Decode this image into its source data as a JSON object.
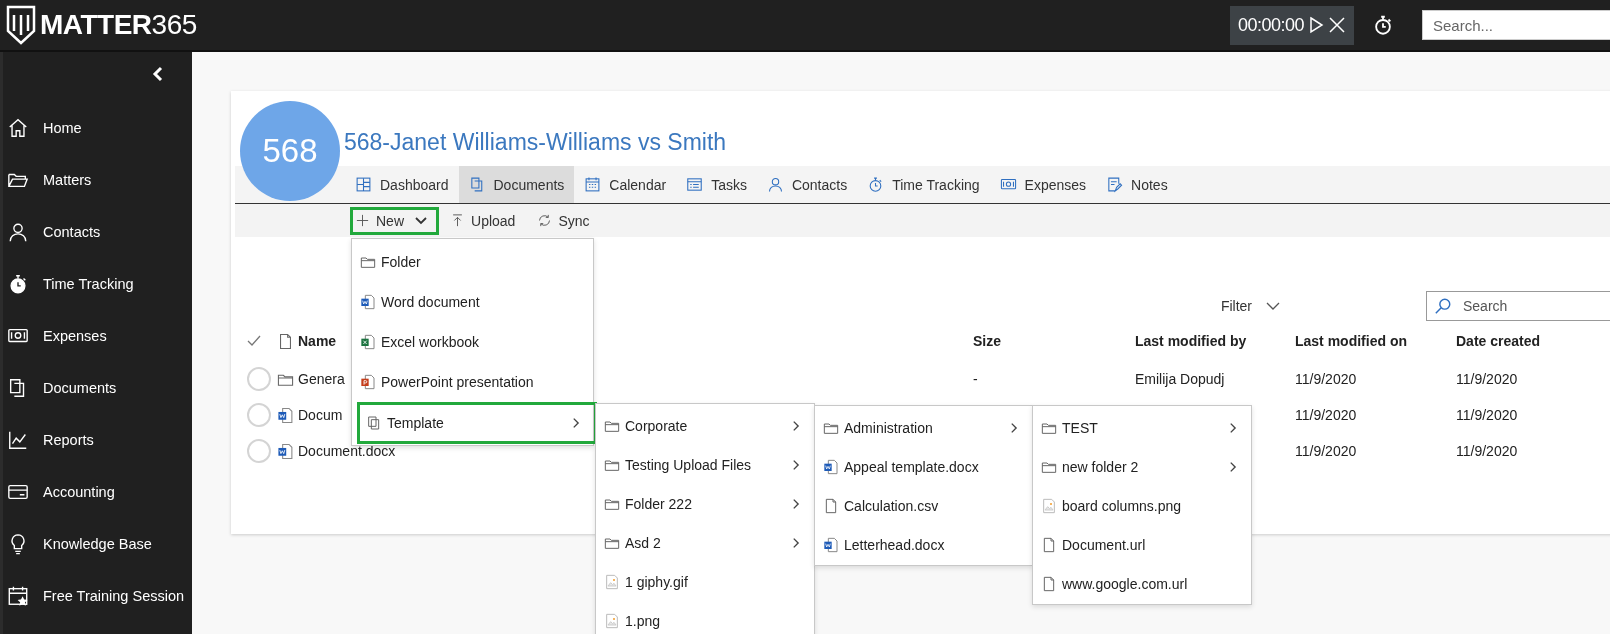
{
  "topbar": {
    "logo": {
      "name": "MATTER",
      "suffix": "365"
    },
    "timer": {
      "time": "00:00:00"
    },
    "search": {
      "placeholder": "Search..."
    }
  },
  "sidebar": {
    "items": [
      {
        "kind": "home",
        "label": "Home"
      },
      {
        "kind": "folder-open",
        "label": "Matters"
      },
      {
        "kind": "person",
        "label": "Contacts"
      },
      {
        "kind": "stopwatch-filled",
        "label": "Time Tracking"
      },
      {
        "kind": "money",
        "label": "Expenses"
      },
      {
        "kind": "documents",
        "label": "Documents"
      },
      {
        "kind": "chart",
        "label": "Reports"
      },
      {
        "kind": "card",
        "label": "Accounting"
      },
      {
        "kind": "bulb",
        "label": "Knowledge Base"
      },
      {
        "kind": "calendar-star",
        "label": "Free Training Session"
      }
    ]
  },
  "matter": {
    "number": "568",
    "title": "568-Janet Williams-Williams vs Smith"
  },
  "tabs": [
    {
      "kind": "dashboard",
      "label": "Dashboard",
      "selected": false
    },
    {
      "kind": "documents",
      "label": "Documents",
      "selected": true
    },
    {
      "kind": "calendar",
      "label": "Calendar",
      "selected": false
    },
    {
      "kind": "tasks",
      "label": "Tasks",
      "selected": false
    },
    {
      "kind": "person",
      "label": "Contacts",
      "selected": false
    },
    {
      "kind": "stopwatch",
      "label": "Time Tracking",
      "selected": false
    },
    {
      "kind": "money",
      "label": "Expenses",
      "selected": false
    },
    {
      "kind": "note",
      "label": "Notes",
      "selected": false
    }
  ],
  "toolbar": [
    {
      "kind": "plus",
      "label": "New",
      "dropdown": true,
      "highlighted": true
    },
    {
      "kind": "upload",
      "label": "Upload",
      "dropdown": false,
      "highlighted": false
    },
    {
      "kind": "sync",
      "label": "Sync",
      "dropdown": false,
      "highlighted": false
    }
  ],
  "filter": {
    "label": "Filter"
  },
  "table_search": {
    "placeholder": "Search"
  },
  "table": {
    "columns": [
      "Name",
      "Size",
      "Last modified by",
      "Last modified on",
      "Date created"
    ],
    "rows": [
      {
        "kind": "folder",
        "selected": false,
        "name": "Genera",
        "size": "-",
        "modified_by": "Emilija Dopudj",
        "modified_on": "11/9/2020",
        "created": "11/9/2020"
      },
      {
        "kind": "word",
        "selected": false,
        "name": "Docum",
        "modified_on": "11/9/2020",
        "created": "11/9/2020"
      },
      {
        "kind": "word",
        "selected": false,
        "name": "Document.docx",
        "modified_on": "11/9/2020",
        "created": "11/9/2020"
      }
    ]
  },
  "menus": [
    {
      "items": [
        {
          "kind": "folder",
          "label": "Folder",
          "submenu": false,
          "highlighted": false
        },
        {
          "kind": "word",
          "label": "Word document",
          "submenu": false,
          "highlighted": false
        },
        {
          "kind": "excel",
          "label": "Excel workbook",
          "submenu": false,
          "highlighted": false
        },
        {
          "kind": "powerpoint",
          "label": "PowerPoint presentation",
          "submenu": false,
          "highlighted": false
        },
        {
          "kind": "template",
          "label": "Template",
          "submenu": true,
          "highlighted": true
        }
      ]
    },
    {
      "items": [
        {
          "kind": "folder",
          "label": "Corporate",
          "submenu": true,
          "highlighted": false
        },
        {
          "kind": "folder",
          "label": "Testing Upload Files",
          "submenu": true,
          "highlighted": false
        },
        {
          "kind": "folder",
          "label": "Folder 222",
          "submenu": true,
          "highlighted": false
        },
        {
          "kind": "folder",
          "label": "Asd 2",
          "submenu": true,
          "highlighted": false
        },
        {
          "kind": "image",
          "label": "1 giphy.gif",
          "submenu": false,
          "highlighted": false
        },
        {
          "kind": "image",
          "label": "1.png",
          "submenu": false,
          "highlighted": false
        }
      ]
    },
    {
      "items": [
        {
          "kind": "folder",
          "label": "Administration",
          "submenu": true,
          "highlighted": false
        },
        {
          "kind": "word",
          "label": "Appeal template.docx",
          "submenu": false,
          "highlighted": false
        },
        {
          "kind": "file",
          "label": "Calculation.csv",
          "submenu": false,
          "highlighted": false
        },
        {
          "kind": "word",
          "label": "Letterhead.docx",
          "submenu": false,
          "highlighted": false
        }
      ]
    },
    {
      "items": [
        {
          "kind": "folder",
          "label": "TEST",
          "submenu": true,
          "highlighted": false
        },
        {
          "kind": "folder",
          "label": "new folder 2",
          "submenu": true,
          "highlighted": false
        },
        {
          "kind": "image",
          "label": "board columns.png",
          "submenu": false,
          "highlighted": false
        },
        {
          "kind": "file",
          "label": "Document.url",
          "submenu": false,
          "highlighted": false
        },
        {
          "kind": "file",
          "label": "www.google.com.url",
          "submenu": false,
          "highlighted": false
        }
      ]
    }
  ]
}
